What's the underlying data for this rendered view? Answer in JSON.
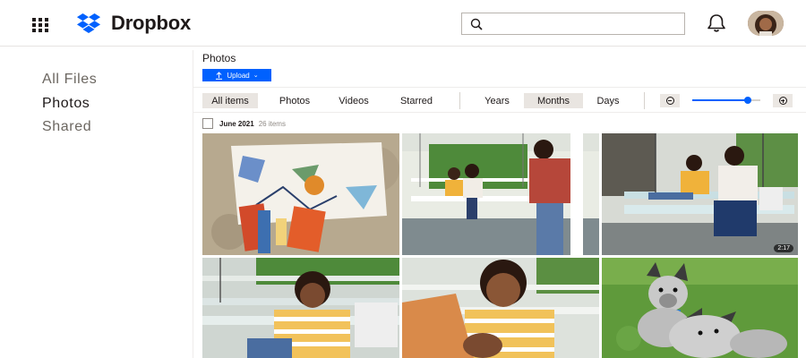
{
  "header": {
    "app_name": "Dropbox",
    "search_placeholder": "",
    "icons": [
      "app-grid-icon",
      "dropbox-logo-icon",
      "search-icon",
      "bell-icon"
    ],
    "brand_color": "#0061fe"
  },
  "sidebar": {
    "items": [
      {
        "label": "All Files",
        "active": false
      },
      {
        "label": "Photos",
        "active": true
      },
      {
        "label": "Shared",
        "active": false
      }
    ]
  },
  "main": {
    "title": "Photos",
    "upload_label": "Upload",
    "filters": [
      "All items",
      "Photos",
      "Videos",
      "Starred"
    ],
    "active_filter": "All items",
    "views": [
      "Years",
      "Months",
      "Days"
    ],
    "active_view": "Months",
    "zoom_level": 0.85,
    "section": {
      "date": "June 2021",
      "count": "26 items"
    },
    "photos": [
      {
        "subject": "collage artwork on sand"
      },
      {
        "subject": "couple on porch swing being photographed"
      },
      {
        "subject": "mother and son on porch swing"
      },
      {
        "subject": "boy in striped shirt on bench"
      },
      {
        "subject": "smiling boy reaching toward camera"
      },
      {
        "subject": "two dogs on grass"
      }
    ],
    "video_duration": "2:17"
  }
}
